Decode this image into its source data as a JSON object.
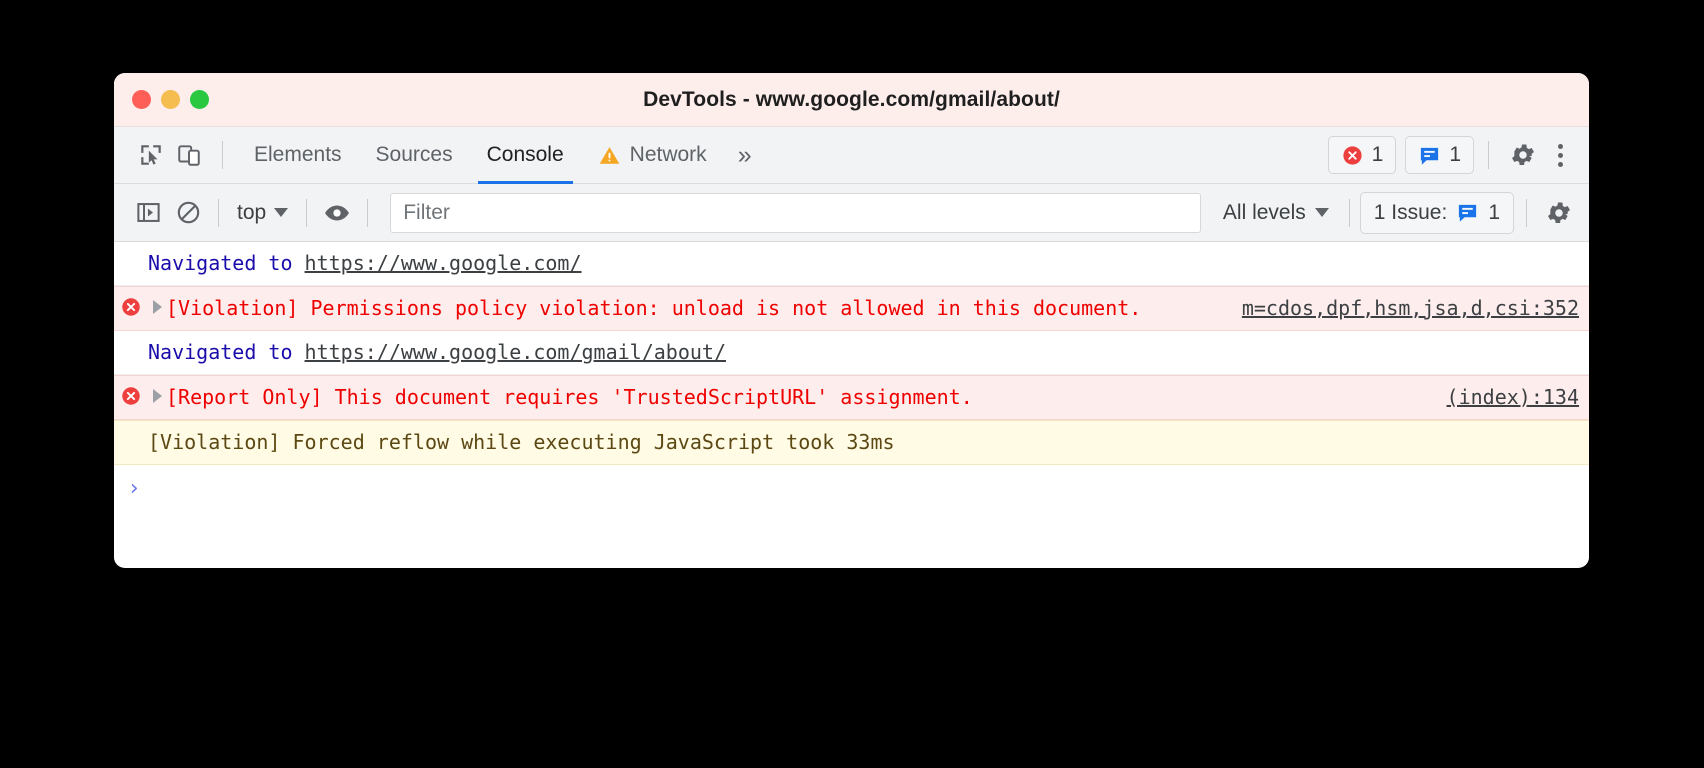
{
  "window": {
    "title": "DevTools - www.google.com/gmail/about/",
    "traffic_lights": [
      "close",
      "minimize",
      "zoom"
    ]
  },
  "tabbar": {
    "inspect_icon": "inspect-cursor-icon",
    "device_toolbar_icon": "device-toolbar-icon",
    "tabs": [
      {
        "label": "Elements",
        "active": false,
        "icon": null
      },
      {
        "label": "Sources",
        "active": false,
        "icon": null
      },
      {
        "label": "Console",
        "active": true,
        "icon": null
      },
      {
        "label": "Network",
        "active": false,
        "icon": "warning-triangle-icon"
      }
    ],
    "more_tabs_label": "»",
    "error_count": "1",
    "message_count": "1",
    "settings_icon": "gear-icon",
    "menu_icon": "kebab-menu-icon"
  },
  "console_toolbar": {
    "sidebar_toggle_icon": "console-sidebar-icon",
    "clear_icon": "clear-console-icon",
    "context_label": "top",
    "eye_icon": "live-expression-eye-icon",
    "filter_placeholder": "Filter",
    "filter_value": "",
    "levels_label": "All levels",
    "issues_label": "1 Issue:",
    "issues_count": "1",
    "settings_icon": "gear-icon"
  },
  "console_messages": [
    {
      "kind": "nav",
      "icon": null,
      "disclosure": false,
      "prefix": "Navigated to ",
      "link": "https://www.google.com/",
      "text": "",
      "source": ""
    },
    {
      "kind": "error",
      "icon": "error-circle-icon",
      "disclosure": true,
      "prefix": "",
      "link": "",
      "text": "[Violation] Permissions policy violation: unload is not allowed in this document.",
      "source": "m=cdos,dpf,hsm,jsa,d,csi:352"
    },
    {
      "kind": "nav",
      "icon": null,
      "disclosure": false,
      "prefix": "Navigated to ",
      "link": "https://www.google.com/gmail/about/",
      "text": "",
      "source": ""
    },
    {
      "kind": "error",
      "icon": "error-circle-icon",
      "disclosure": true,
      "prefix": "",
      "link": "",
      "text": "[Report Only] This document requires 'TrustedScriptURL' assignment.",
      "source": "(index):134"
    },
    {
      "kind": "warn",
      "icon": null,
      "disclosure": false,
      "prefix": "",
      "link": "",
      "text": "[Violation] Forced reflow while executing JavaScript took 33ms",
      "source": ""
    }
  ],
  "prompt": {
    "chevron": "›",
    "value": ""
  },
  "colors": {
    "titlebar_bg": "#fdeeec",
    "toolbar_bg": "#f1f3f4",
    "active_tab_underline": "#1a73e8",
    "error_bg": "#fdeded",
    "error_text": "#ef0000",
    "warn_bg": "#fffbe5",
    "nav_text": "#1a0dab",
    "issue_blue": "#1a73e8",
    "error_red": "#ee3f3f",
    "warning_orange": "#f5a623"
  }
}
